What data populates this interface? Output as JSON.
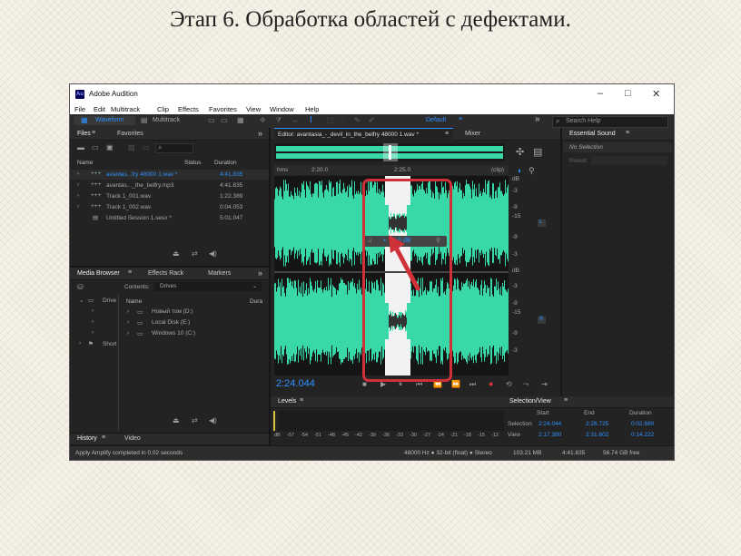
{
  "slide": {
    "title": "Этап 6. Обработка областей с дефектами."
  },
  "app": {
    "title": "Adobe Audition",
    "logo": "Au",
    "window_controls": {
      "minimize": "–",
      "maximize": "□",
      "close": "✕"
    }
  },
  "menu": [
    "File",
    "Edit",
    "Multitrack",
    "Clip",
    "Effects",
    "Favorites",
    "View",
    "Window",
    "Help"
  ],
  "toolbar": {
    "waveform": "Waveform",
    "multitrack": "Multitrack",
    "workspace": "Default",
    "search_placeholder": "Search Help",
    "expand": "»"
  },
  "files_panel": {
    "tabs": [
      "Files",
      "Favorites"
    ],
    "columns": {
      "name": "Name",
      "status": "Status",
      "duration": "Duration"
    },
    "rows": [
      {
        "name": "avantas...fry 48000 1.wav *",
        "duration": "4:41.835",
        "selected": true
      },
      {
        "name": "avantas..._the_belfry.mp3",
        "duration": "4:41.835"
      },
      {
        "name": "Track 1_001.wav",
        "duration": "1:22.389"
      },
      {
        "name": "Track 1_002.wav",
        "duration": "0:04.053"
      },
      {
        "name": "Untitled Session 1.sesx *",
        "duration": "5:01.047"
      }
    ]
  },
  "media_panel": {
    "tabs": [
      "Media Browser",
      "Effects Rack",
      "Markers"
    ],
    "contents_label": "Contents:",
    "contents_value": "Drives",
    "columns": {
      "name": "Name",
      "duration": "Dura"
    },
    "tree": [
      "Drive",
      "Short"
    ],
    "items": [
      "Новый том (D:)",
      "Local Disk (E:)",
      "Windows 10 (C:)"
    ]
  },
  "history_panel": {
    "tabs": [
      "History",
      "Video"
    ],
    "status": "Apply Amplify completed in 0.02 seconds"
  },
  "editor": {
    "tab": "Editor: avantasia_-_devil_in_the_belfry 48000 1.wav *",
    "mixer_tab": "Mixer",
    "ruler": {
      "unit": "hms",
      "time1": "2:20.0",
      "time2": "2:25.0",
      "clip": "(clip)"
    },
    "db_ticks_top": [
      "dB",
      "-3",
      "-9",
      "-15",
      "-9",
      "-3"
    ],
    "db_ticks_bottom": [
      "dB",
      "-3",
      "-9",
      "-15",
      "-9",
      "-3"
    ],
    "channels": [
      "L",
      "R"
    ],
    "hud_value": "+0 dB",
    "time": "2:24.044"
  },
  "levels_panel": {
    "title": "Levels",
    "scale": [
      "dB",
      "-57",
      "-54",
      "-51",
      "-48",
      "-45",
      "-42",
      "-39",
      "-36",
      "-33",
      "-30",
      "-27",
      "-24",
      "-21",
      "-18",
      "-15",
      "-12",
      "-9",
      "-6",
      "-3",
      "0"
    ]
  },
  "essential_sound": {
    "title": "Essential Sound",
    "no_selection": "No Selection",
    "preset_label": "Preset:"
  },
  "selection_view": {
    "title": "Selection/View",
    "headers": [
      "Start",
      "End",
      "Duration"
    ],
    "rows": [
      {
        "label": "Selection",
        "start": "2:24.044",
        "end": "2:26.725",
        "duration": "0:02.680"
      },
      {
        "label": "View",
        "start": "2:17.380",
        "end": "2:31.602",
        "duration": "0:14.222"
      }
    ]
  },
  "status_bar": {
    "format": "48000 Hz ● 32-bit (float) ● Stereo",
    "size": "103.21 MB",
    "duration": "4:41.835",
    "free": "56.74 GB free"
  },
  "colors": {
    "waveform": "#38d8a8",
    "accent": "#2f92ff",
    "highlight": "#d03139"
  }
}
